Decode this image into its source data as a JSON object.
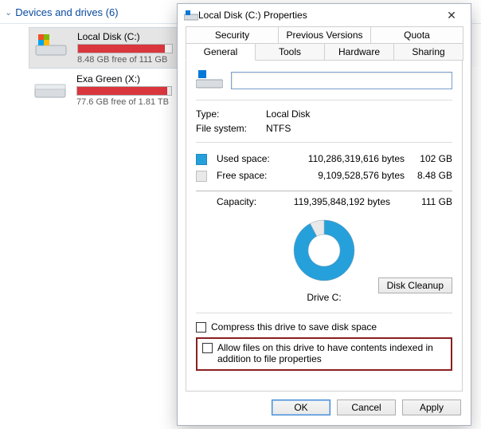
{
  "explorer": {
    "section_label": "Devices and drives (6)",
    "drives": [
      {
        "name": "Local Disk (C:)",
        "free_text": "8.48 GB free of 111 GB",
        "fill_pct": 92
      },
      {
        "name": "Exa Green (X:)",
        "free_text": "77.6 GB free of 1.81 TB",
        "fill_pct": 96
      }
    ]
  },
  "dialog": {
    "title": "Local Disk (C:) Properties",
    "tabs_row1": [
      "Security",
      "Previous Versions",
      "Quota"
    ],
    "tabs_row2": [
      "General",
      "Tools",
      "Hardware",
      "Sharing"
    ],
    "active_tab": "General",
    "type_label": "Type:",
    "type_value": "Local Disk",
    "fs_label": "File system:",
    "fs_value": "NTFS",
    "used_label": "Used space:",
    "used_bytes": "110,286,319,616 bytes",
    "used_hr": "102 GB",
    "free_label": "Free space:",
    "free_bytes": "9,109,528,576 bytes",
    "free_hr": "8.48 GB",
    "capacity_label": "Capacity:",
    "capacity_bytes": "119,395,848,192 bytes",
    "capacity_hr": "111 GB",
    "drive_caption": "Drive C:",
    "disk_cleanup": "Disk Cleanup",
    "compress_label": "Compress this drive to save disk space",
    "index_label": "Allow files on this drive to have contents indexed in addition to file properties",
    "ok": "OK",
    "cancel": "Cancel",
    "apply": "Apply"
  },
  "chart_data": {
    "type": "pie",
    "title": "Drive C:",
    "series": [
      {
        "name": "Used space",
        "value": 110286319616,
        "color": "#26a0da"
      },
      {
        "name": "Free space",
        "value": 9109528576,
        "color": "#e9e9e9"
      }
    ]
  }
}
